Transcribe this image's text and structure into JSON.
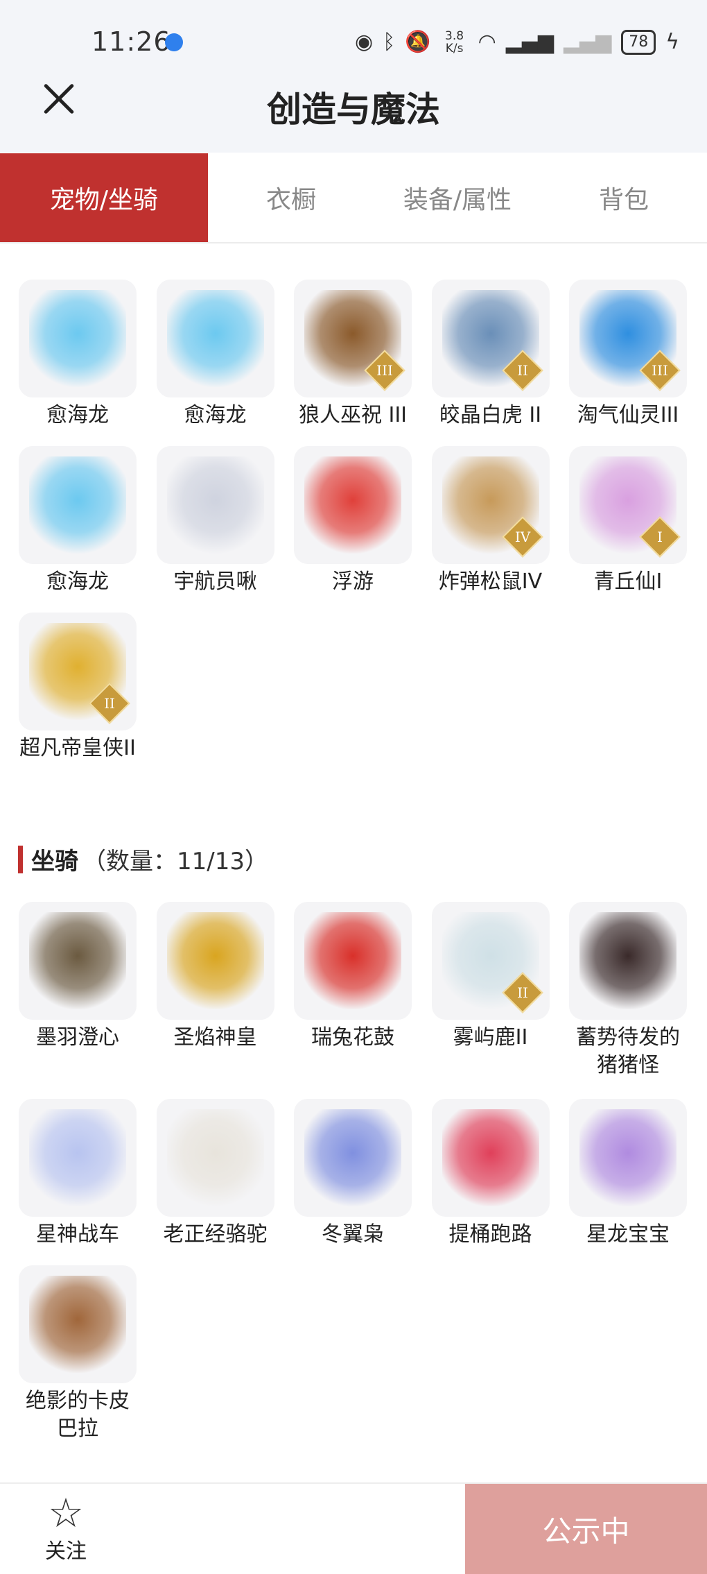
{
  "status_bar": {
    "time": "11:26",
    "net_speed_value": "3.8",
    "net_speed_unit": "K/s",
    "battery": "78",
    "icons": [
      "eye-icon",
      "bluetooth-icon",
      "mute-icon",
      "wifi-icon",
      "signal-icon",
      "signal-none-icon",
      "charging-icon"
    ]
  },
  "header": {
    "title": "创造与魔法",
    "close_icon": "close-icon"
  },
  "tabs": [
    {
      "label": "宠物/坐骑",
      "active": true
    },
    {
      "label": "衣橱",
      "active": false
    },
    {
      "label": "装备/属性",
      "active": false
    },
    {
      "label": "背包",
      "active": false
    }
  ],
  "pets": {
    "items": [
      {
        "name": "愈海龙",
        "badge": "",
        "color": "#6cc9f0"
      },
      {
        "name": "愈海龙",
        "badge": "",
        "color": "#6cc9f0"
      },
      {
        "name": "狼人巫祝 III",
        "badge": "III",
        "color": "#8b5a2b"
      },
      {
        "name": "皎晶白虎 II",
        "badge": "II",
        "color": "#6a8fb8"
      },
      {
        "name": "淘气仙灵III",
        "badge": "III",
        "color": "#2f8fe0"
      },
      {
        "name": "愈海龙",
        "badge": "",
        "color": "#6cc9f0"
      },
      {
        "name": "宇航员啾",
        "badge": "",
        "color": "#cfd3df"
      },
      {
        "name": "浮游",
        "badge": "",
        "color": "#e0403a"
      },
      {
        "name": "炸弹松鼠IV",
        "badge": "IV",
        "color": "#c79a5a"
      },
      {
        "name": "青丘仙I",
        "badge": "I",
        "color": "#d9a0e0"
      },
      {
        "name": "超凡帝皇侠II",
        "badge": "II",
        "color": "#e0b030"
      }
    ]
  },
  "mounts": {
    "title": "坐骑",
    "count": "（数量：11/13）",
    "items": [
      {
        "name": "墨羽澄心",
        "badge": "",
        "color": "#6b5a40"
      },
      {
        "name": "圣焰神皇",
        "badge": "",
        "color": "#d9a520"
      },
      {
        "name": "瑞兔花鼓",
        "badge": "",
        "color": "#d9302a"
      },
      {
        "name": "雾屿鹿II",
        "badge": "II",
        "color": "#cfe0e6"
      },
      {
        "name": "蓄势待发的猪猪怪",
        "badge": "",
        "color": "#3a2a2a"
      },
      {
        "name": "星神战车",
        "badge": "",
        "color": "#b8c4f0"
      },
      {
        "name": "老正经骆驼",
        "badge": "",
        "color": "#e8e4dc"
      },
      {
        "name": "冬翼枭",
        "badge": "",
        "color": "#8090e0"
      },
      {
        "name": "提桶跑路",
        "badge": "",
        "color": "#e0405a"
      },
      {
        "name": "星龙宝宝",
        "badge": "",
        "color": "#b08be0"
      },
      {
        "name": "绝影的卡皮巴拉",
        "badge": "",
        "color": "#a0663a"
      }
    ]
  },
  "bottom": {
    "follow_label": "关注",
    "follow_icon": "star-icon",
    "public_label": "公示中"
  }
}
